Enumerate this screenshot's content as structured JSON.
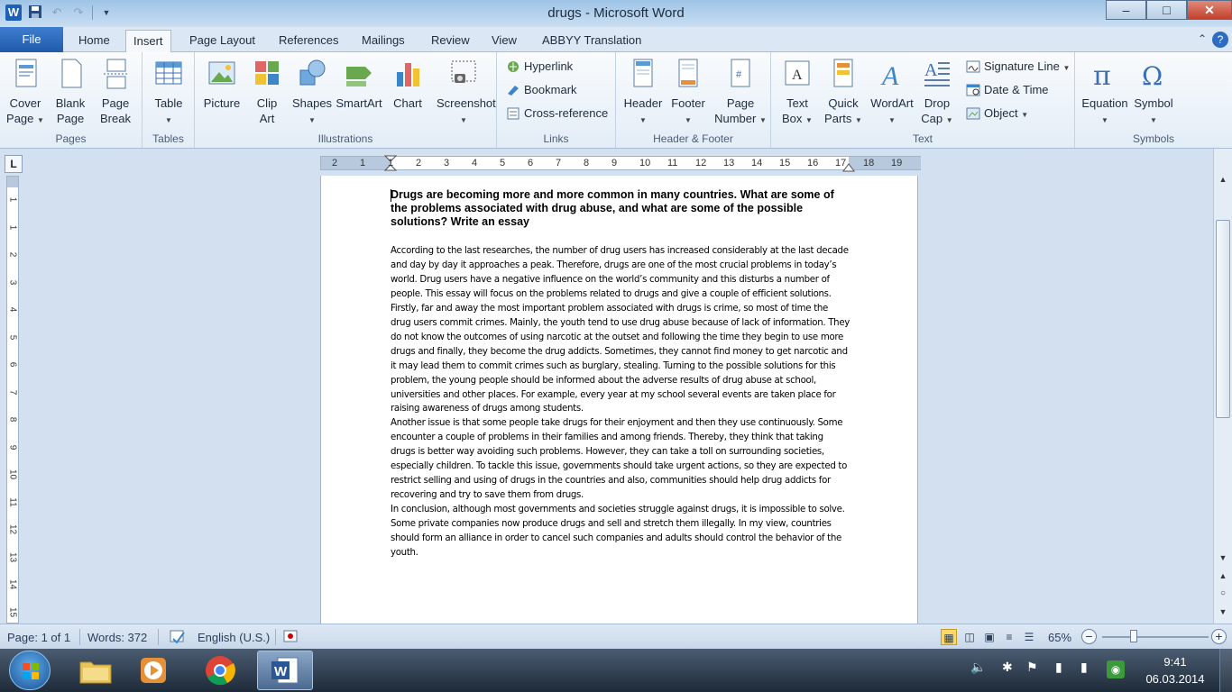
{
  "window": {
    "title": "drugs - Microsoft Word",
    "minimize": "–",
    "maximize": "□",
    "close": "✕"
  },
  "qat": {
    "save_icon": "save-icon",
    "undo_icon": "undo-icon",
    "redo_icon": "redo-icon"
  },
  "tabs": {
    "file": "File",
    "home": "Home",
    "insert": "Insert",
    "page_layout": "Page Layout",
    "references": "References",
    "mailings": "Mailings",
    "review": "Review",
    "view": "View",
    "abbyy": "ABBYY Translation"
  },
  "ribbon": {
    "pages": {
      "label": "Pages",
      "cover_page": [
        "Cover",
        "Page"
      ],
      "blank_page": [
        "Blank",
        "Page"
      ],
      "page_break": [
        "Page",
        "Break"
      ]
    },
    "tables": {
      "label": "Tables",
      "table": "Table"
    },
    "illustrations": {
      "label": "Illustrations",
      "picture": "Picture",
      "clip_art": [
        "Clip",
        "Art"
      ],
      "shapes": "Shapes",
      "smartart": "SmartArt",
      "chart": "Chart",
      "screenshot": "Screenshot"
    },
    "links": {
      "label": "Links",
      "hyperlink": "Hyperlink",
      "bookmark": "Bookmark",
      "cross_reference": "Cross-reference"
    },
    "header_footer": {
      "label": "Header & Footer",
      "header": "Header",
      "footer": "Footer",
      "page_number": [
        "Page",
        "Number"
      ]
    },
    "text": {
      "label": "Text",
      "text_box": [
        "Text",
        "Box"
      ],
      "quick_parts": [
        "Quick",
        "Parts"
      ],
      "wordart": "WordArt",
      "drop_cap": [
        "Drop",
        "Cap"
      ],
      "signature_line": "Signature Line",
      "date_time": "Date & Time",
      "object": "Object"
    },
    "symbols": {
      "label": "Symbols",
      "equation": "Equation",
      "symbol": "Symbol"
    }
  },
  "ruler": {
    "tab_selector": "L",
    "h_ticks": [
      "2",
      "1",
      "1",
      "2",
      "3",
      "4",
      "5",
      "6",
      "7",
      "8",
      "9",
      "10",
      "11",
      "12",
      "13",
      "14",
      "15",
      "16",
      "17",
      "18",
      "19"
    ],
    "v_ticks": [
      "1",
      "1",
      "2",
      "3",
      "4",
      "5",
      "6",
      "7",
      "8",
      "9",
      "10",
      "11",
      "12",
      "13",
      "14",
      "15"
    ]
  },
  "document": {
    "title": "Drugs are becoming more and more common in many countries. What are some of the problems associated with drug abuse, and what are some of the possible solutions? Write an essay",
    "paragraphs": [
      "According to the last researches, the number of drug users has increased considerably at the last decade and day by day it approaches a peak. Therefore, drugs are one of the most crucial problems in today’s world. Drug users have a negative influence on the world’s community and this disturbs a number of people. This essay will focus on the problems related to drugs and give a couple of efficient solutions.",
      "Firstly, far and away the most important problem associated with drugs is crime, so most of time the drug users commit crimes. Mainly, the youth tend to use drug abuse because of lack of information. They do not know the outcomes of using narcotic at the outset and following the time they begin to use more drugs and finally, they become the drug addicts. Sometimes, they cannot find money to get narcotic and it may lead them to commit crimes such as burglary, stealing. Turning to the possible solutions for this problem, the young people should be informed about the adverse results of drug abuse at school, universities and other places. For example, every year at my school several events are taken place for raising awareness of drugs among students.",
      "Another issue is that some people take drugs for their enjoyment and then they use continuously. Some encounter a couple of problems in their families and among friends. Thereby, they think that taking drugs is better way avoiding such problems. However, they can take a toll on surrounding societies, especially children. To tackle this issue, governments should take urgent actions, so they are expected to restrict selling and using of drugs in the countries and also, communities should help drug addicts for recovering and try to save them from drugs.",
      "In conclusion, although most governments and societies struggle against drugs, it is impossible to solve. Some private companies now produce drugs and sell and stretch them illegally. In my view, countries should form an alliance in order to cancel such companies and adults should control the behavior of the youth."
    ]
  },
  "statusbar": {
    "page": "Page: 1 of 1",
    "words": "Words: 372",
    "language": "English (U.S.)",
    "zoom": "65%",
    "zoom_level": 0.65
  },
  "taskbar": {
    "apps": [
      "windows-explorer",
      "media-player",
      "chrome",
      "microsoft-word"
    ],
    "time": "9:41",
    "date": "06.03.2014"
  },
  "colors": {
    "accent": "#1f5aa9",
    "ribbon_bg": "#e3edf7",
    "workspace_bg": "#d3e0ef"
  }
}
